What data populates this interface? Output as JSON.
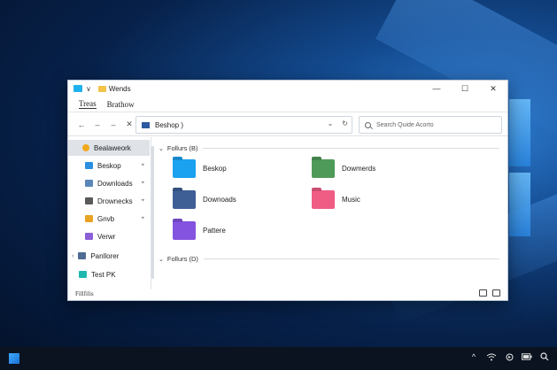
{
  "window": {
    "title": "Wends",
    "controls": {
      "minimize": "—",
      "maximize": "☐",
      "close": "✕"
    }
  },
  "menu": {
    "items": [
      "Treas",
      "Brathow"
    ]
  },
  "nav": {
    "back": "←",
    "forward": "–",
    "up": "–",
    "close": "✕",
    "address": "Beshop  )",
    "address_dropdown": "⌄",
    "refresh": "↻",
    "search_placeholder": "Search Quide Acorto"
  },
  "sidebar": {
    "items": [
      {
        "label": "Bealaweork",
        "icon": "star-icon",
        "color": "#f2a81d",
        "pinned": false,
        "selected": true,
        "indent": false
      },
      {
        "label": "Beskop",
        "icon": "desktop-folder-icon",
        "color": "#2a8fe0",
        "pinned": true,
        "selected": false,
        "indent": true
      },
      {
        "label": "Downloads",
        "icon": "downloads-folder-icon",
        "color": "#5b87b8",
        "pinned": true,
        "selected": false,
        "indent": true
      },
      {
        "label": "Drownecks",
        "icon": "documents-folder-icon",
        "color": "#5a5a5a",
        "pinned": true,
        "selected": false,
        "indent": true
      },
      {
        "label": "Gnvb",
        "icon": "pictures-folder-icon",
        "color": "#e8a323",
        "pinned": true,
        "selected": false,
        "indent": true
      },
      {
        "label": "Verwr",
        "icon": "videos-folder-icon",
        "color": "#8b5fd6",
        "pinned": false,
        "selected": false,
        "indent": true
      },
      {
        "label": "Panllorer",
        "icon": "pc-icon",
        "color": "#4f6c92",
        "pinned": false,
        "selected": false,
        "indent": false,
        "chevron": "›"
      },
      {
        "label": "Test PK",
        "icon": "drive-icon",
        "color": "#1fb7b0",
        "pinned": false,
        "selected": false,
        "indent": false
      }
    ],
    "pin_glyph": "⌖"
  },
  "content": {
    "groups": [
      {
        "label": "Follurs (B)",
        "chevron": "⌄",
        "folders": [
          {
            "label": "Beskop",
            "icon": "desktop-folder-icon",
            "color": "#1aa1f0"
          },
          {
            "label": "Dowmerds",
            "icon": "documents-folder-icon",
            "color": "#4e9a58"
          },
          {
            "label": "Downoads",
            "icon": "downloads-folder-icon",
            "color": "#3d5f96"
          },
          {
            "label": "Music",
            "icon": "music-folder-icon",
            "color": "#ef5c84"
          },
          {
            "label": "Pattere",
            "icon": "pictures-folder-icon",
            "color": "#8454e0"
          }
        ]
      },
      {
        "label": "Follurs (D)",
        "chevron": "⌄",
        "folders": []
      }
    ]
  },
  "status": {
    "text": "Fillfilis"
  },
  "taskbar": {
    "tray": {
      "chevron": "^",
      "wifi": "wifi-icon",
      "volume": "volume-icon",
      "battery": "battery-icon",
      "search": "search-icon"
    }
  }
}
